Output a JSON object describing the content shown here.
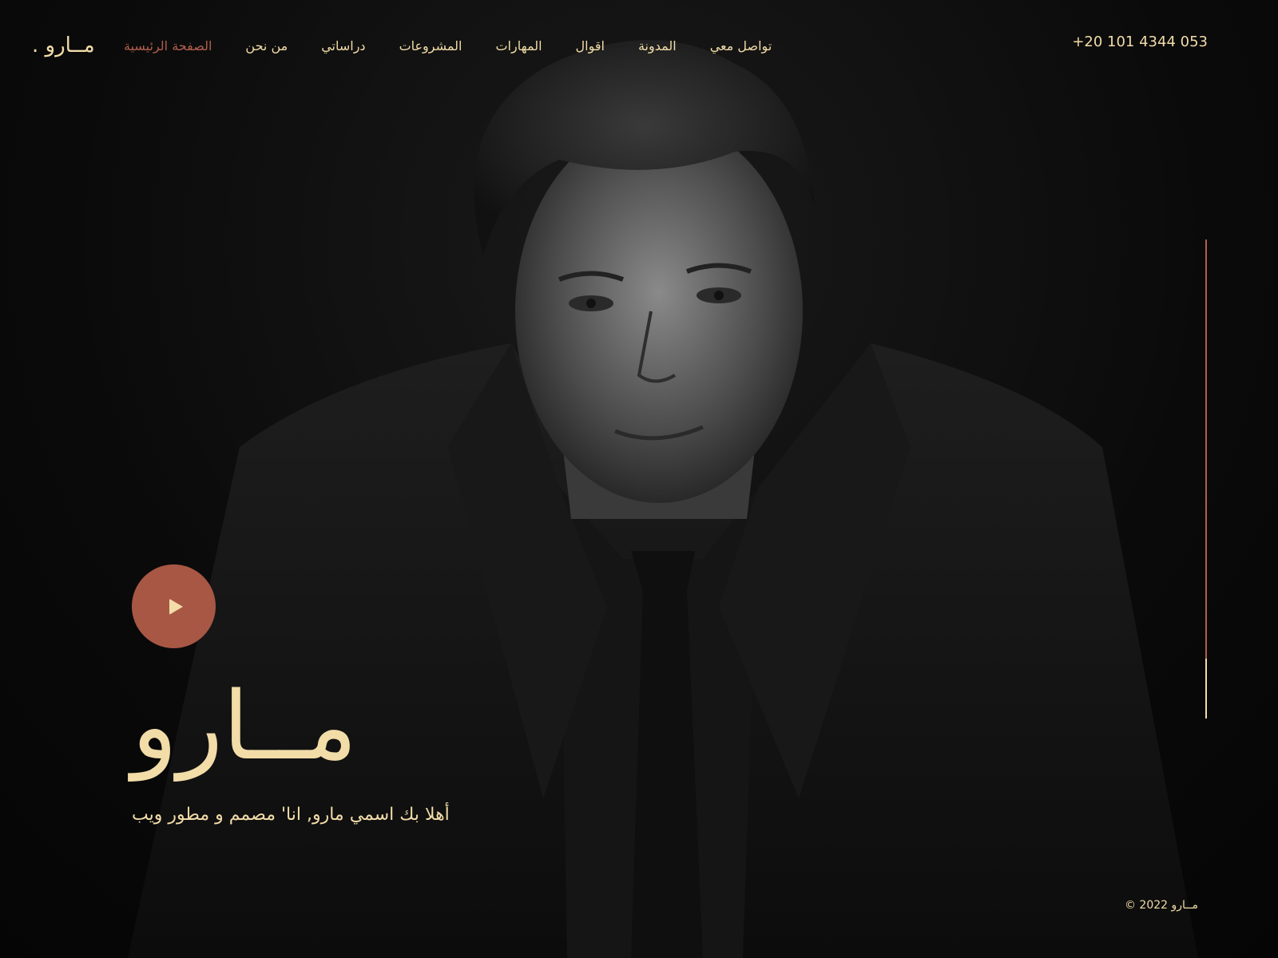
{
  "header": {
    "logo": "مــارو .",
    "phone": "+20 101 4344 053",
    "nav": [
      {
        "label": "الصفحة الرئيسية",
        "active": true
      },
      {
        "label": "من نحن",
        "active": false
      },
      {
        "label": "دراساتي",
        "active": false
      },
      {
        "label": "المشروعات",
        "active": false
      },
      {
        "label": "المهارات",
        "active": false
      },
      {
        "label": "اقوال",
        "active": false
      },
      {
        "label": "المدونة",
        "active": false
      },
      {
        "label": "تواصل معي",
        "active": false
      }
    ]
  },
  "hero": {
    "name": "مــارو",
    "tagline": "أهلا بك اسمي مارو, انا' مصمم و مطور ويب",
    "play_icon": "play-icon"
  },
  "footer": {
    "copyright": "مــارو 2022 ©"
  },
  "colors": {
    "accent": "#b05f4b",
    "text": "#f2dca8",
    "background": "#0b0b0b"
  }
}
